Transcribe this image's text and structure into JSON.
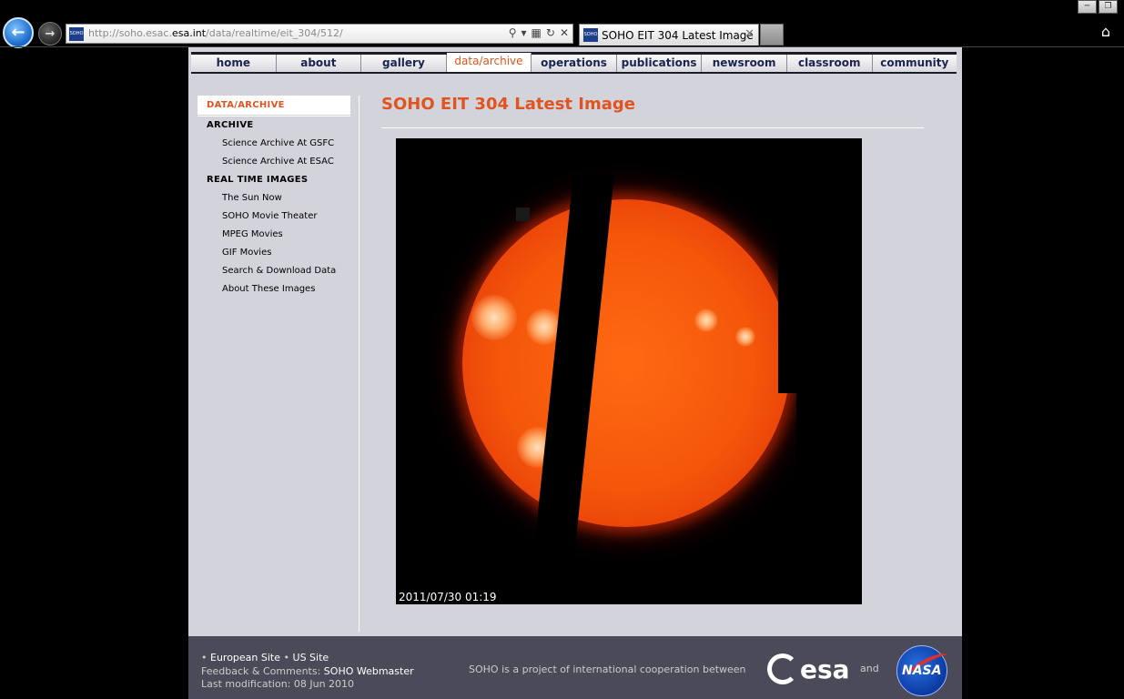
{
  "browser": {
    "url_prefix": "http://soho.esac.",
    "url_domain": "esa.int",
    "url_path": "/data/realtime/eit_304/512/",
    "tab_title": "SOHO EIT 304 Latest Image",
    "favicon_text": "SOHO"
  },
  "nav": {
    "items": [
      {
        "label": "home"
      },
      {
        "label": "about"
      },
      {
        "label": "gallery"
      },
      {
        "label": "data/archive"
      },
      {
        "label": "operations"
      },
      {
        "label": "publications"
      },
      {
        "label": "newsroom"
      },
      {
        "label": "classroom"
      },
      {
        "label": "community"
      }
    ],
    "active_index": 3
  },
  "sidebar": {
    "active": "DATA/ARCHIVE",
    "archive_heading": "ARCHIVE",
    "archive_links": [
      "Science Archive At GSFC",
      "Science Archive At ESAC"
    ],
    "realtime_heading": "REAL TIME IMAGES",
    "realtime_links": [
      "The Sun Now",
      "SOHO Movie Theater",
      "MPEG Movies",
      "GIF Movies",
      "Search & Download Data",
      "About These Images"
    ]
  },
  "main": {
    "title": "SOHO EIT 304 Latest Image",
    "image_timestamp": "2011/07/30 01:19"
  },
  "footer": {
    "european_site": "European Site",
    "us_site": "US Site",
    "feedback_label": "Feedback & Comments:",
    "webmaster": "SOHO Webmaster",
    "last_mod": "Last modification: 08 Jun 2010",
    "coop": "SOHO is a project of international cooperation between",
    "and": "and",
    "esa_logo_text": "esa",
    "nasa_logo_text": "NASA"
  },
  "colors": {
    "accent": "#e0541f",
    "nav_text": "#1b2450",
    "page_bg": "#d3d3db",
    "footer_bg": "#4a4a58"
  }
}
